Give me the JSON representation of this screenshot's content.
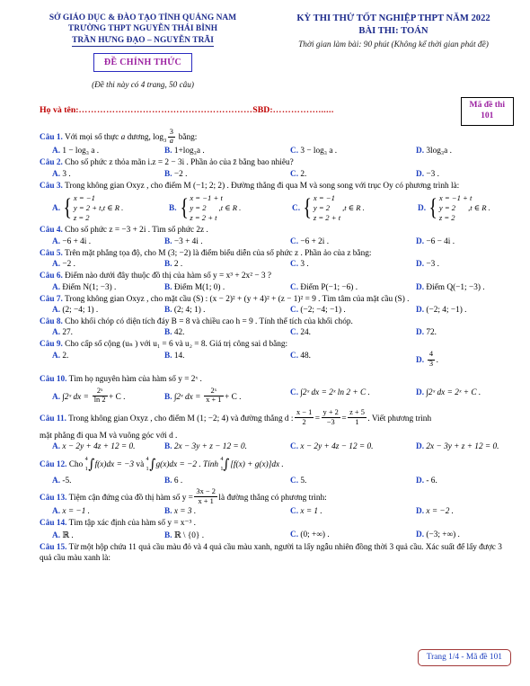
{
  "header": {
    "department": "SỞ GIÁO DỤC & ĐÀO TẠO TỈNH QUẢNG NAM",
    "school": "TRƯỜNG THPT NGUYỄN THÁI BÌNH",
    "school2": "TRẦN HƯNG ĐẠO – NGUYỄN TRÃI",
    "official_label": "ĐỀ CHÍNH THỨC",
    "pages_note": "(Đề thi này có 4 trang, 50 câu)",
    "exam_title": "KỲ THI THỬ TỐT NGHIỆP THPT NĂM 2022",
    "exam_subject": "BÀI THI: TOÁN",
    "exam_time": "Thời gian làm bài: 90 phút (Không kể thời gian phát đề)",
    "code_label": "Mã đề thi",
    "code_value": "101",
    "colors": {
      "heading_blue": "#1d2b8c",
      "purple": "#9b1fa0",
      "red": "#c00000",
      "question_blue": "#1d3fbf",
      "footer_border": "#a33a3a"
    }
  },
  "name_line": {
    "name_label": "Họ và tên:",
    "name_dots": "…………………………………………………",
    "sbd_label": "SBD:",
    "sbd_dots": "……………......"
  },
  "questions": [
    {
      "id": "q1",
      "label": "Câu 1.",
      "text_pre": "Với mọi số thực ",
      "var_a": "a",
      "text_mid": " dương, ",
      "log_base": "3",
      "frac_num": "3",
      "frac_den": "a",
      "text_post": " bằng:",
      "options": [
        {
          "id": "A.",
          "text": "1 − log₃ a ."
        },
        {
          "id": "B.",
          "text": "1+log₃a ."
        },
        {
          "id": "C.",
          "text": "3 − log₃ a ."
        },
        {
          "id": "D.",
          "text": "3log₃a ."
        }
      ]
    },
    {
      "id": "q2",
      "label": "Câu 2.",
      "text": "Cho số phức z thỏa mãn i.z = 2 − 3i . Phần ảo của z̄ bằng bao nhiêu?",
      "options": [
        {
          "id": "A.",
          "text": "3 ."
        },
        {
          "id": "B.",
          "text": "−2 ."
        },
        {
          "id": "C.",
          "text": "2."
        },
        {
          "id": "D.",
          "text": "−3 ."
        }
      ]
    },
    {
      "id": "q3",
      "label": "Câu 3.",
      "text": "Trong không gian Oxyz , cho điểm M (−1; 2; 2) . Đường thẳng đi qua M  và song song với trục Oy có phương trình là:",
      "systems": [
        {
          "id": "A.",
          "lines": [
            "x = −1",
            "y = 2 + t",
            "z = 2"
          ],
          "tail": ",t ∈ R .",
          "tail_inline": true
        },
        {
          "id": "B.",
          "lines": [
            "x = −1 + t",
            "y = 2",
            "z = 2 + t"
          ],
          "tail": ",t ∈ R .",
          "tail_inline": false
        },
        {
          "id": "C.",
          "lines": [
            "x = −1",
            "y = 2",
            "z = 2 + t"
          ],
          "tail": ",t ∈ R .",
          "tail_inline": false
        },
        {
          "id": "D.",
          "lines": [
            "x = −1 + t",
            "y = 2",
            "z = 2"
          ],
          "tail": ",t ∈ R .",
          "tail_inline": false
        }
      ]
    },
    {
      "id": "q4",
      "label": "Câu 4.",
      "text": "Cho số phức z = −3 + 2i . Tìm số phức 2z .",
      "options": [
        {
          "id": "A.",
          "text": "−6 + 4i ."
        },
        {
          "id": "B.",
          "text": "−3 + 4i ."
        },
        {
          "id": "C.",
          "text": "−6 + 2i ."
        },
        {
          "id": "D.",
          "text": "−6 − 4i ."
        }
      ]
    },
    {
      "id": "q5",
      "label": "Câu 5.",
      "text": "Trên mặt phẳng tọa độ, cho M (3; −2) là điểm biểu diễn của số phức z . Phần ảo của z bằng:",
      "options": [
        {
          "id": "A.",
          "text": "−2 ."
        },
        {
          "id": "B.",
          "text": "2 ."
        },
        {
          "id": "C.",
          "text": "3 ."
        },
        {
          "id": "D.",
          "text": "−3 ."
        }
      ]
    },
    {
      "id": "q6",
      "label": "Câu 6.",
      "text": "Điểm nào dưới đây thuộc đồ thị của hàm số y = x³ + 2x² − 3 ?",
      "options": [
        {
          "id": "A.",
          "text": "Điểm N(1; −3) ."
        },
        {
          "id": "B.",
          "text": "Điểm M(1; 0) ."
        },
        {
          "id": "C.",
          "text": "Điểm P(−1; −6) ."
        },
        {
          "id": "D.",
          "text": "Điểm Q(−1; −3) ."
        }
      ]
    },
    {
      "id": "q7",
      "label": "Câu 7.",
      "text": "Trong không gian Oxyz , cho mặt cầu (S) : (x − 2)² + (y + 4)² + (z − 1)² = 9 . Tìm tâm của mặt cầu (S) .",
      "options": [
        {
          "id": "A.",
          "text": "(2; −4; 1) ."
        },
        {
          "id": "B.",
          "text": "(2; 4; 1) ."
        },
        {
          "id": "C.",
          "text": "(−2; −4; −1) ."
        },
        {
          "id": "D.",
          "text": "(−2; 4; −1) ."
        }
      ]
    },
    {
      "id": "q8",
      "label": "Câu 8.",
      "text": "Cho khối chóp có diện tích đáy B = 8 và chiều cao h = 9 . Tính thể tích của khối chóp.",
      "options": [
        {
          "id": "A.",
          "text": "27."
        },
        {
          "id": "B.",
          "text": "42."
        },
        {
          "id": "C.",
          "text": "24."
        },
        {
          "id": "D.",
          "text": "72."
        }
      ]
    },
    {
      "id": "q9",
      "label": "Câu 9.",
      "text": "Cho cấp số cộng (uₙ ) với u₁ = 6 và u₂ = 8. Giá trị công sai d bằng:",
      "options": [
        {
          "id": "A.",
          "text": "2."
        },
        {
          "id": "B.",
          "text": "14."
        },
        {
          "id": "C.",
          "text": "48."
        },
        {
          "id": "D.",
          "text": "",
          "frac": {
            "num": "4",
            "den": "3"
          },
          "suffix": "."
        }
      ]
    },
    {
      "id": "q10",
      "label": "Câu 10.",
      "text": "Tìm họ nguyên hàm của hàm số y = 2ˣ .",
      "options": [
        {
          "id": "A.",
          "pre": "∫2ˣ dx = ",
          "frac": {
            "num": "2ˣ",
            "den": "ln 2"
          },
          "post": "+ C ."
        },
        {
          "id": "B.",
          "pre": "∫2ˣ dx = ",
          "frac": {
            "num": "2ˣ",
            "den": "x + 1"
          },
          "post": "+ C ."
        },
        {
          "id": "C.",
          "pre": "∫2ˣ dx = 2ˣ ln 2 + C .",
          "frac": null,
          "post": ""
        },
        {
          "id": "D.",
          "pre": "∫2ˣ dx = 2ˣ + C .",
          "frac": null,
          "post": ""
        }
      ]
    },
    {
      "id": "q11",
      "label": "Câu 11.",
      "text_a": "Trong không gian Oxyz , cho điểm M (1; −2; 4) và đường thẳng d :",
      "fracs": [
        {
          "num": "x − 1",
          "den": "2"
        },
        {
          "num": "y + 2",
          "den": "−3"
        },
        {
          "num": "z + 5",
          "den": "1"
        }
      ],
      "text_b": ". Viết phương trình",
      "text_c": "mặt phẳng đi qua M  và vuông góc với d .",
      "options": [
        {
          "id": "A.",
          "text": "x − 2y + 4z + 12 = 0."
        },
        {
          "id": "B.",
          "text": "2x − 3y + z − 12 = 0."
        },
        {
          "id": "C.",
          "text": "x − 2y + 4z − 12 = 0."
        },
        {
          "id": "D.",
          "text": "2x − 3y + z + 12 = 0."
        }
      ]
    },
    {
      "id": "q12",
      "label": "Câu 12.",
      "text_a": "Cho",
      "int1": {
        "hi": "4",
        "lo": "1",
        "body": "f(x)dx = −3"
      },
      "text_b": "và",
      "int2": {
        "hi": "4",
        "lo": "1",
        "body": "g(x)dx = −2 . Tính"
      },
      "int3": {
        "hi": "4",
        "lo": "1",
        "body": "[f(x) + g(x)]dx ."
      },
      "options": [
        {
          "id": "A.",
          "text": "-5."
        },
        {
          "id": "B.",
          "text": "6 ."
        },
        {
          "id": "C.",
          "text": "5."
        },
        {
          "id": "D.",
          "text": "- 6."
        }
      ]
    },
    {
      "id": "q13",
      "label": "Câu 13.",
      "text_a": "Tiệm cận đứng của đồ thị hàm số y =",
      "frac": {
        "num": "3x − 2",
        "den": "x + 1"
      },
      "text_b": "là đường thẳng có phương trình:",
      "options": [
        {
          "id": "A.",
          "text": "x = −1 ."
        },
        {
          "id": "B.",
          "text": "x = 3 ."
        },
        {
          "id": "C.",
          "text": "x = 1 ."
        },
        {
          "id": "D.",
          "text": "x = −2 ."
        }
      ]
    },
    {
      "id": "q14",
      "label": "Câu 14.",
      "text": "Tìm tập xác định của hàm số y = x⁻³ .",
      "options": [
        {
          "id": "A.",
          "text": "ℝ ."
        },
        {
          "id": "B.",
          "text": "ℝ \\ {0} ."
        },
        {
          "id": "C.",
          "text": "(0; +∞) ."
        },
        {
          "id": "D.",
          "text": "(−3; +∞) ."
        }
      ]
    },
    {
      "id": "q15",
      "label": "Câu 15.",
      "text": "Từ một hộp chứa 11 quả cầu màu đỏ và 4 quả cầu màu xanh, người ta lấy ngẫu nhiên đồng thời 3 quả cầu. Xác suất để lấy được 3 quả cầu màu xanh là:"
    }
  ],
  "footer": {
    "text": "Trang 1/4 - Mã đề 101"
  }
}
